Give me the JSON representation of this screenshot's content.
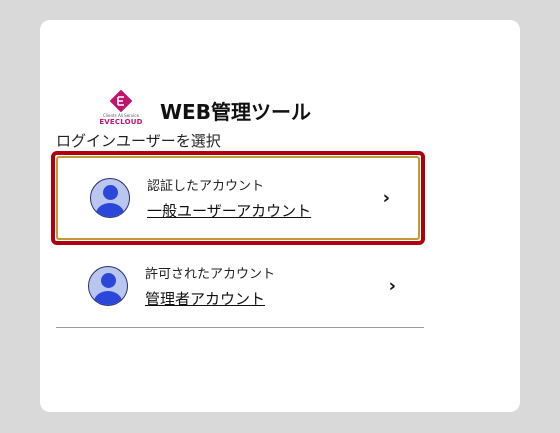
{
  "header": {
    "logo_sub": "Clients Ali Service",
    "logo_brand": "EVECLOUD",
    "title": "WEB管理ツール"
  },
  "section_label": "ログインユーザーを選択",
  "accounts": [
    {
      "type": "認証したアカウント",
      "name": "一般ユーザーアカウント",
      "selected": true
    },
    {
      "type": "許可されたアカウント",
      "name": "管理者アカウント",
      "selected": false
    }
  ],
  "icons": {
    "avatar": "user-avatar-icon",
    "chevron": "chevron-right-icon",
    "logo": "evecloud-logo-icon"
  },
  "colors": {
    "focus_ring": "#b0000e",
    "selected_border": "#c19a3a",
    "avatar_fg": "#2b47d9",
    "avatar_bg": "#b9c6ef",
    "brand": "#c0146e"
  }
}
